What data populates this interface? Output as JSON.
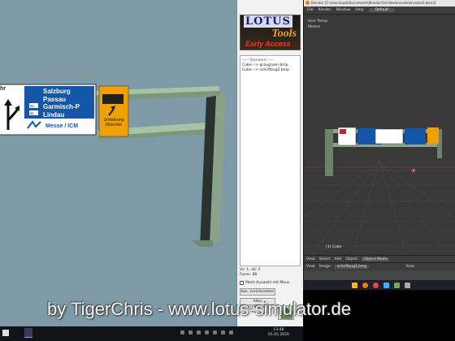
{
  "viewport": {
    "sign_left_fragment": "hr",
    "sign_destinations": [
      "Salzburg",
      "Passau",
      "Garmisch-P",
      "Lindau"
    ],
    "sign_route_badges": [
      "",
      "",
      "93",
      "96"
    ],
    "sign_lower_label": "Messe / ICM",
    "detour_sign_lines": [
      "Umfahrung",
      "München"
    ]
  },
  "tools": {
    "logo_line1": "LOTUS",
    "logo_line2": "Tools",
    "logo_line3": "Early Access",
    "list_header": "----- Standard -----",
    "list_items": [
      "Cube --> graugruen.bmp",
      "Cube --> schriftzug2.bmp"
    ],
    "info_vertices": "Vs: 1, aS: 2",
    "info_faces": "Faces: 88",
    "checkbox_label": "Mesh Auswahl mit Maus",
    "reset_button": "bas. zurücksetzen",
    "select_button": "Alles deselektieren"
  },
  "blender": {
    "title": "Blender [C:\\Users\\laub\\Documents\\Blender\\Schilderbruecke\\bruecke2.blend]",
    "menu": [
      "File",
      "Render",
      "Window",
      "Help"
    ],
    "workspace": "Default",
    "view_label_1": "User Persp",
    "view_label_2": "Meters",
    "object_label": "(1) Cube",
    "header_items": [
      "View",
      "Select",
      "Add",
      "Object"
    ],
    "mode": "Object Mode",
    "header2_items": [
      "View",
      "Image"
    ],
    "image_name": "schriftzug2.bmp",
    "header2_view": "View"
  },
  "taskbar": {
    "time": "13:48",
    "date": "01.05.2020"
  },
  "watermark": "by TigerChris - www.lotus-simulator.de",
  "colors": {
    "sign_blue": "#1457a8",
    "sign_orange": "#f0a000",
    "gantry_green": "#9fb89c",
    "sky": "#7e9aa6",
    "blender_bg": "#393939"
  }
}
